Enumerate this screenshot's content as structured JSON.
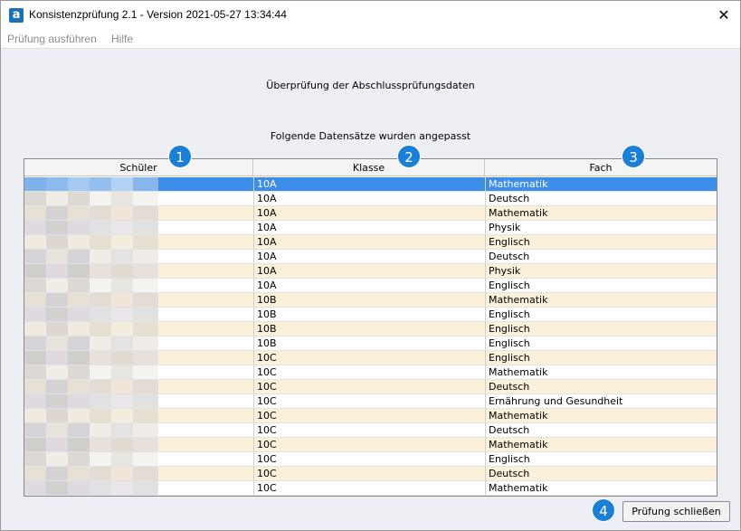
{
  "window": {
    "title": "Konsistenzprüfung 2.1 - Version 2021-05-27 13:34:44",
    "icon_letter": "a",
    "close_symbol": "✕"
  },
  "menu": {
    "items": [
      "Prüfung ausführen",
      "Hilfe"
    ]
  },
  "content": {
    "heading": "Überprüfung der Abschlussprüfungsdaten",
    "subheading": "Folgende Datensätze wurden angepasst"
  },
  "table": {
    "columns": [
      "Schüler",
      "Klasse",
      "Fach"
    ],
    "selected_row": 0,
    "rows": [
      {
        "klasse": "10A",
        "fach": "Mathematik"
      },
      {
        "klasse": "10A",
        "fach": "Deutsch"
      },
      {
        "klasse": "10A",
        "fach": "Mathematik"
      },
      {
        "klasse": "10A",
        "fach": "Physik"
      },
      {
        "klasse": "10A",
        "fach": "Englisch"
      },
      {
        "klasse": "10A",
        "fach": "Deutsch"
      },
      {
        "klasse": "10A",
        "fach": "Physik"
      },
      {
        "klasse": "10A",
        "fach": "Englisch"
      },
      {
        "klasse": "10B",
        "fach": "Mathematik"
      },
      {
        "klasse": "10B",
        "fach": "Englisch"
      },
      {
        "klasse": "10B",
        "fach": "Englisch"
      },
      {
        "klasse": "10B",
        "fach": "Englisch"
      },
      {
        "klasse": "10C",
        "fach": "Englisch"
      },
      {
        "klasse": "10C",
        "fach": "Mathematik"
      },
      {
        "klasse": "10C",
        "fach": "Deutsch"
      },
      {
        "klasse": "10C",
        "fach": "Ernährung und Gesundheit"
      },
      {
        "klasse": "10C",
        "fach": "Mathematik"
      },
      {
        "klasse": "10C",
        "fach": "Deutsch"
      },
      {
        "klasse": "10C",
        "fach": "Mathematik"
      },
      {
        "klasse": "10C",
        "fach": "Englisch"
      },
      {
        "klasse": "10C",
        "fach": "Deutsch"
      },
      {
        "klasse": "10C",
        "fach": "Mathematik"
      }
    ]
  },
  "badges": [
    "1",
    "2",
    "3",
    "4"
  ],
  "footer": {
    "close_button_label": "Prüfung schließen"
  },
  "colors": {
    "selection": "#3d8ee8",
    "row_alt": "#fbf1da",
    "badge": "#1b7fd6",
    "content_bg": "#eeeef5"
  }
}
